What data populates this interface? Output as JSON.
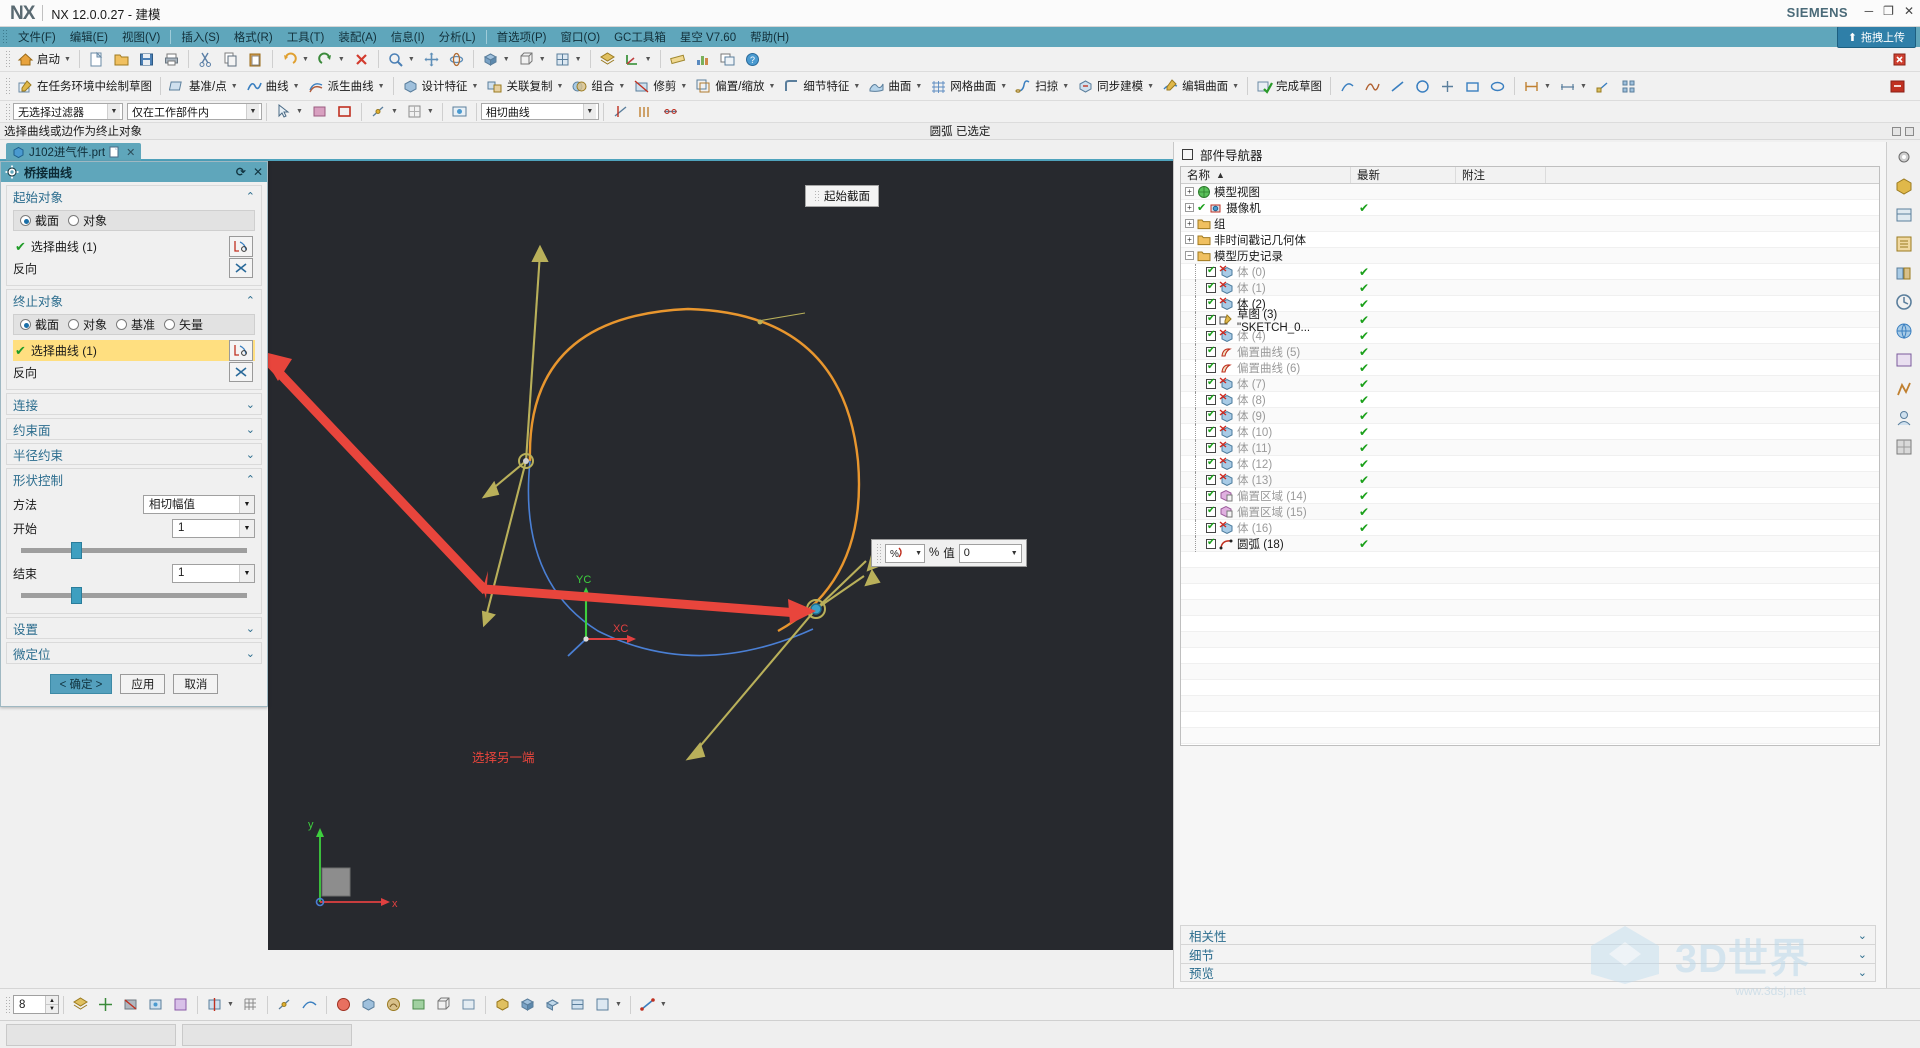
{
  "titlebar": {
    "logo": "NX",
    "title": "NX 12.0.0.27 - 建模",
    "brand": "SIEMENS",
    "min": "─",
    "max": "❐",
    "close": "✕"
  },
  "menubar": {
    "items": [
      {
        "label": "文件(F)"
      },
      {
        "label": "编辑(E)"
      },
      {
        "label": "视图(V)"
      },
      {
        "label": "插入(S)"
      },
      {
        "label": "格式(R)"
      },
      {
        "label": "工具(T)"
      },
      {
        "label": "装配(A)"
      },
      {
        "label": "信息(I)"
      },
      {
        "label": "分析(L)"
      },
      {
        "label": "首选项(P)"
      },
      {
        "label": "窗口(O)"
      },
      {
        "label": "GC工具箱"
      },
      {
        "label": "星空 V7.60"
      },
      {
        "label": "帮助(H)"
      }
    ],
    "upload_button": "拖拽上传"
  },
  "toolbar_row1": [
    {
      "label": "启动",
      "icon": "home-icon"
    },
    {
      "label": "",
      "icon": "new-doc-icon"
    },
    {
      "label": "",
      "icon": "open-folder-icon"
    },
    {
      "label": "",
      "icon": "save-icon"
    },
    {
      "label": "",
      "icon": "print-icon"
    },
    {
      "label": "",
      "icon": "cut-icon"
    },
    {
      "label": "",
      "icon": "copy-icon"
    },
    {
      "label": "",
      "icon": "paste-icon"
    },
    {
      "label": "",
      "icon": "undo-icon"
    },
    {
      "label": "",
      "icon": "redo-icon"
    },
    {
      "label": "",
      "icon": "delete-icon"
    },
    {
      "label": "",
      "icon": "zoom-fit-icon"
    },
    {
      "label": "",
      "icon": "pan-icon"
    },
    {
      "label": "",
      "icon": "rotate-icon"
    },
    {
      "label": "",
      "icon": "shaded-view-icon"
    },
    {
      "label": "",
      "icon": "wireframe-icon"
    },
    {
      "label": "",
      "icon": "orient-view-icon"
    },
    {
      "label": "",
      "icon": "layer-icon"
    },
    {
      "label": "",
      "icon": "wcs-icon"
    },
    {
      "label": "",
      "icon": "measure-icon"
    },
    {
      "label": "",
      "icon": "analysis-icon"
    },
    {
      "label": "",
      "icon": "window-icon"
    },
    {
      "label": "",
      "icon": "help-icon"
    }
  ],
  "toolbar_row2": [
    {
      "label": "在任务环境中绘制草图",
      "icon": "sketch-env-icon"
    },
    {
      "label": "基准/点",
      "icon": "datum-icon"
    },
    {
      "label": "曲线",
      "icon": "curve-icon"
    },
    {
      "label": "派生曲线",
      "icon": "derived-curve-icon"
    },
    {
      "label": "设计特征",
      "icon": "design-feature-icon"
    },
    {
      "label": "关联复制",
      "icon": "assoc-copy-icon"
    },
    {
      "label": "组合",
      "icon": "combine-icon"
    },
    {
      "label": "修剪",
      "icon": "trim-icon"
    },
    {
      "label": "偏置/缩放",
      "icon": "offset-scale-icon"
    },
    {
      "label": "细节特征",
      "icon": "detail-feature-icon"
    },
    {
      "label": "曲面",
      "icon": "surface-icon"
    },
    {
      "label": "网格曲面",
      "icon": "mesh-surface-icon"
    },
    {
      "label": "扫掠",
      "icon": "sweep-icon"
    },
    {
      "label": "同步建模",
      "icon": "sync-model-icon"
    },
    {
      "label": "编辑曲面",
      "icon": "edit-surface-icon"
    },
    {
      "label": "完成草图",
      "icon": "finish-sketch-icon"
    }
  ],
  "filter_bar": {
    "selection_filter": "无选择过滤器",
    "scope": "仅在工作部件内",
    "curve_rule": "相切曲线"
  },
  "cue": {
    "text": "选择曲线或边作为终止对象",
    "status_center": "圆弧 已选定"
  },
  "file_tab": {
    "name": "J102进气件.prt",
    "close": "✕"
  },
  "dialog": {
    "title": "桥接曲线",
    "title_icons": {
      "refresh": "⟳",
      "close": "✕"
    },
    "start_object": {
      "header": "起始对象",
      "radios": [
        {
          "label": "截面",
          "selected": true
        },
        {
          "label": "对象",
          "selected": false
        }
      ],
      "select_curve": "选择曲线 (1)",
      "reverse": "反向"
    },
    "end_object": {
      "header": "终止对象",
      "radios": [
        {
          "label": "截面",
          "selected": true
        },
        {
          "label": "对象",
          "selected": false
        },
        {
          "label": "基准",
          "selected": false
        },
        {
          "label": "矢量",
          "selected": false
        }
      ],
      "select_curve": "选择曲线 (1)",
      "reverse": "反向"
    },
    "collapsed_sections": [
      "连接",
      "约束面",
      "半径约束"
    ],
    "shape_control": {
      "header": "形状控制",
      "method_label": "方法",
      "method_value": "相切幅值",
      "start_label": "开始",
      "start_value": "1",
      "end_label": "结束",
      "end_value": "1"
    },
    "bottom_sections": [
      "设置",
      "微定位"
    ],
    "buttons": {
      "ok": "< 确定 >",
      "apply": "应用",
      "cancel": "取消"
    }
  },
  "viewport": {
    "start_section_label": "起始截面",
    "hint_text": "选择另一端",
    "triad": {
      "x": "XC",
      "y": "YC"
    },
    "float_toolbar": {
      "percent_label": "%",
      "value_label": "值",
      "value": "0"
    },
    "colors": {
      "orange_curve": "#e8962e",
      "blue_curve": "#4a7fd4",
      "arrow_olive": "#b9b05a",
      "hint_red": "#e8453c",
      "background": "#27292e"
    }
  },
  "part_navigator": {
    "title": "部件导航器",
    "columns": [
      "名称",
      "最新",
      "附注"
    ],
    "sort_arrow": "▲",
    "rows": [
      {
        "name": "模型视图",
        "expander": "+",
        "icon": "model-view-icon",
        "checkbox": false,
        "status": "",
        "depth": 0,
        "dim": false
      },
      {
        "name": "摄像机",
        "expander": "+",
        "icon": "camera-icon",
        "checkbox": false,
        "status": "✔",
        "depth": 0,
        "dim": false
      },
      {
        "name": "组",
        "expander": "+",
        "icon": "folder-icon",
        "checkbox": false,
        "status": "",
        "depth": 0,
        "dim": false
      },
      {
        "name": "非时间戳记几何体",
        "expander": "+",
        "icon": "folder-icon",
        "checkbox": false,
        "status": "",
        "depth": 0,
        "dim": false
      },
      {
        "name": "模型历史记录",
        "expander": "−",
        "icon": "folder-icon",
        "checkbox": false,
        "status": "",
        "depth": 0,
        "dim": false
      },
      {
        "name": "体 (0)",
        "expander": "",
        "icon": "body-icon",
        "checkbox": true,
        "status": "✔",
        "depth": 1,
        "dim": true
      },
      {
        "name": "体 (1)",
        "expander": "",
        "icon": "body-icon",
        "checkbox": true,
        "status": "✔",
        "depth": 1,
        "dim": true
      },
      {
        "name": "体 (2)",
        "expander": "",
        "icon": "body-icon",
        "checkbox": true,
        "status": "✔",
        "depth": 1,
        "dim": false
      },
      {
        "name": "草图 (3) \"SKETCH_0...",
        "expander": "",
        "icon": "sketch-icon",
        "checkbox": true,
        "status": "✔",
        "depth": 1,
        "dim": false
      },
      {
        "name": "体 (4)",
        "expander": "",
        "icon": "body-icon",
        "checkbox": true,
        "status": "✔",
        "depth": 1,
        "dim": true
      },
      {
        "name": "偏置曲线 (5)",
        "expander": "",
        "icon": "offset-curve-icon",
        "checkbox": true,
        "status": "✔",
        "depth": 1,
        "dim": true
      },
      {
        "name": "偏置曲线 (6)",
        "expander": "",
        "icon": "offset-curve-icon",
        "checkbox": true,
        "status": "✔",
        "depth": 1,
        "dim": true
      },
      {
        "name": "体 (7)",
        "expander": "",
        "icon": "body-icon",
        "checkbox": true,
        "status": "✔",
        "depth": 1,
        "dim": true
      },
      {
        "name": "体 (8)",
        "expander": "",
        "icon": "body-icon",
        "checkbox": true,
        "status": "✔",
        "depth": 1,
        "dim": true
      },
      {
        "name": "体 (9)",
        "expander": "",
        "icon": "body-icon",
        "checkbox": true,
        "status": "✔",
        "depth": 1,
        "dim": true
      },
      {
        "name": "体 (10)",
        "expander": "",
        "icon": "body-icon",
        "checkbox": true,
        "status": "✔",
        "depth": 1,
        "dim": true
      },
      {
        "name": "体 (11)",
        "expander": "",
        "icon": "body-icon",
        "checkbox": true,
        "status": "✔",
        "depth": 1,
        "dim": true
      },
      {
        "name": "体 (12)",
        "expander": "",
        "icon": "body-icon",
        "checkbox": true,
        "status": "✔",
        "depth": 1,
        "dim": true
      },
      {
        "name": "体 (13)",
        "expander": "",
        "icon": "body-icon",
        "checkbox": true,
        "status": "✔",
        "depth": 1,
        "dim": true
      },
      {
        "name": "偏置区域 (14)",
        "expander": "",
        "icon": "offset-region-icon",
        "checkbox": true,
        "status": "✔",
        "depth": 1,
        "dim": true
      },
      {
        "name": "偏置区域 (15)",
        "expander": "",
        "icon": "offset-region-icon",
        "checkbox": true,
        "status": "✔",
        "depth": 1,
        "dim": true
      },
      {
        "name": "体 (16)",
        "expander": "",
        "icon": "body-icon",
        "checkbox": true,
        "status": "✔",
        "depth": 1,
        "dim": true
      },
      {
        "name": "圆弧 (18)",
        "expander": "",
        "icon": "arc-icon",
        "checkbox": true,
        "status": "✔",
        "depth": 1,
        "dim": false
      }
    ],
    "sections": [
      "相关性",
      "细节",
      "预览"
    ]
  },
  "bottom_toolbar": {
    "layer_value": "8",
    "items": [
      {
        "icon": "layer-settings-icon"
      },
      {
        "icon": "move-object-icon"
      },
      {
        "icon": "hide-icon"
      },
      {
        "icon": "show-all-icon"
      },
      {
        "icon": "edit-display-icon"
      },
      {
        "icon": "section-icon"
      },
      {
        "icon": "grid-icon"
      },
      {
        "icon": "snap-point-icon"
      },
      {
        "icon": "curve-snap-icon"
      },
      {
        "icon": "render-icon"
      },
      {
        "icon": "shaded-icon"
      },
      {
        "icon": "studio-icon"
      },
      {
        "icon": "face-analysis-icon"
      },
      {
        "icon": "wireframe2-icon"
      },
      {
        "icon": "static-wire-icon"
      },
      {
        "icon": "box-icon"
      },
      {
        "icon": "iso-view-icon"
      },
      {
        "icon": "trimetric-icon"
      },
      {
        "icon": "top-view-icon"
      },
      {
        "icon": "front-view-icon"
      },
      {
        "icon": "line-tool-icon"
      }
    ]
  },
  "watermark": {
    "text": "3D世界",
    "sub": "www.3dsj.net"
  }
}
